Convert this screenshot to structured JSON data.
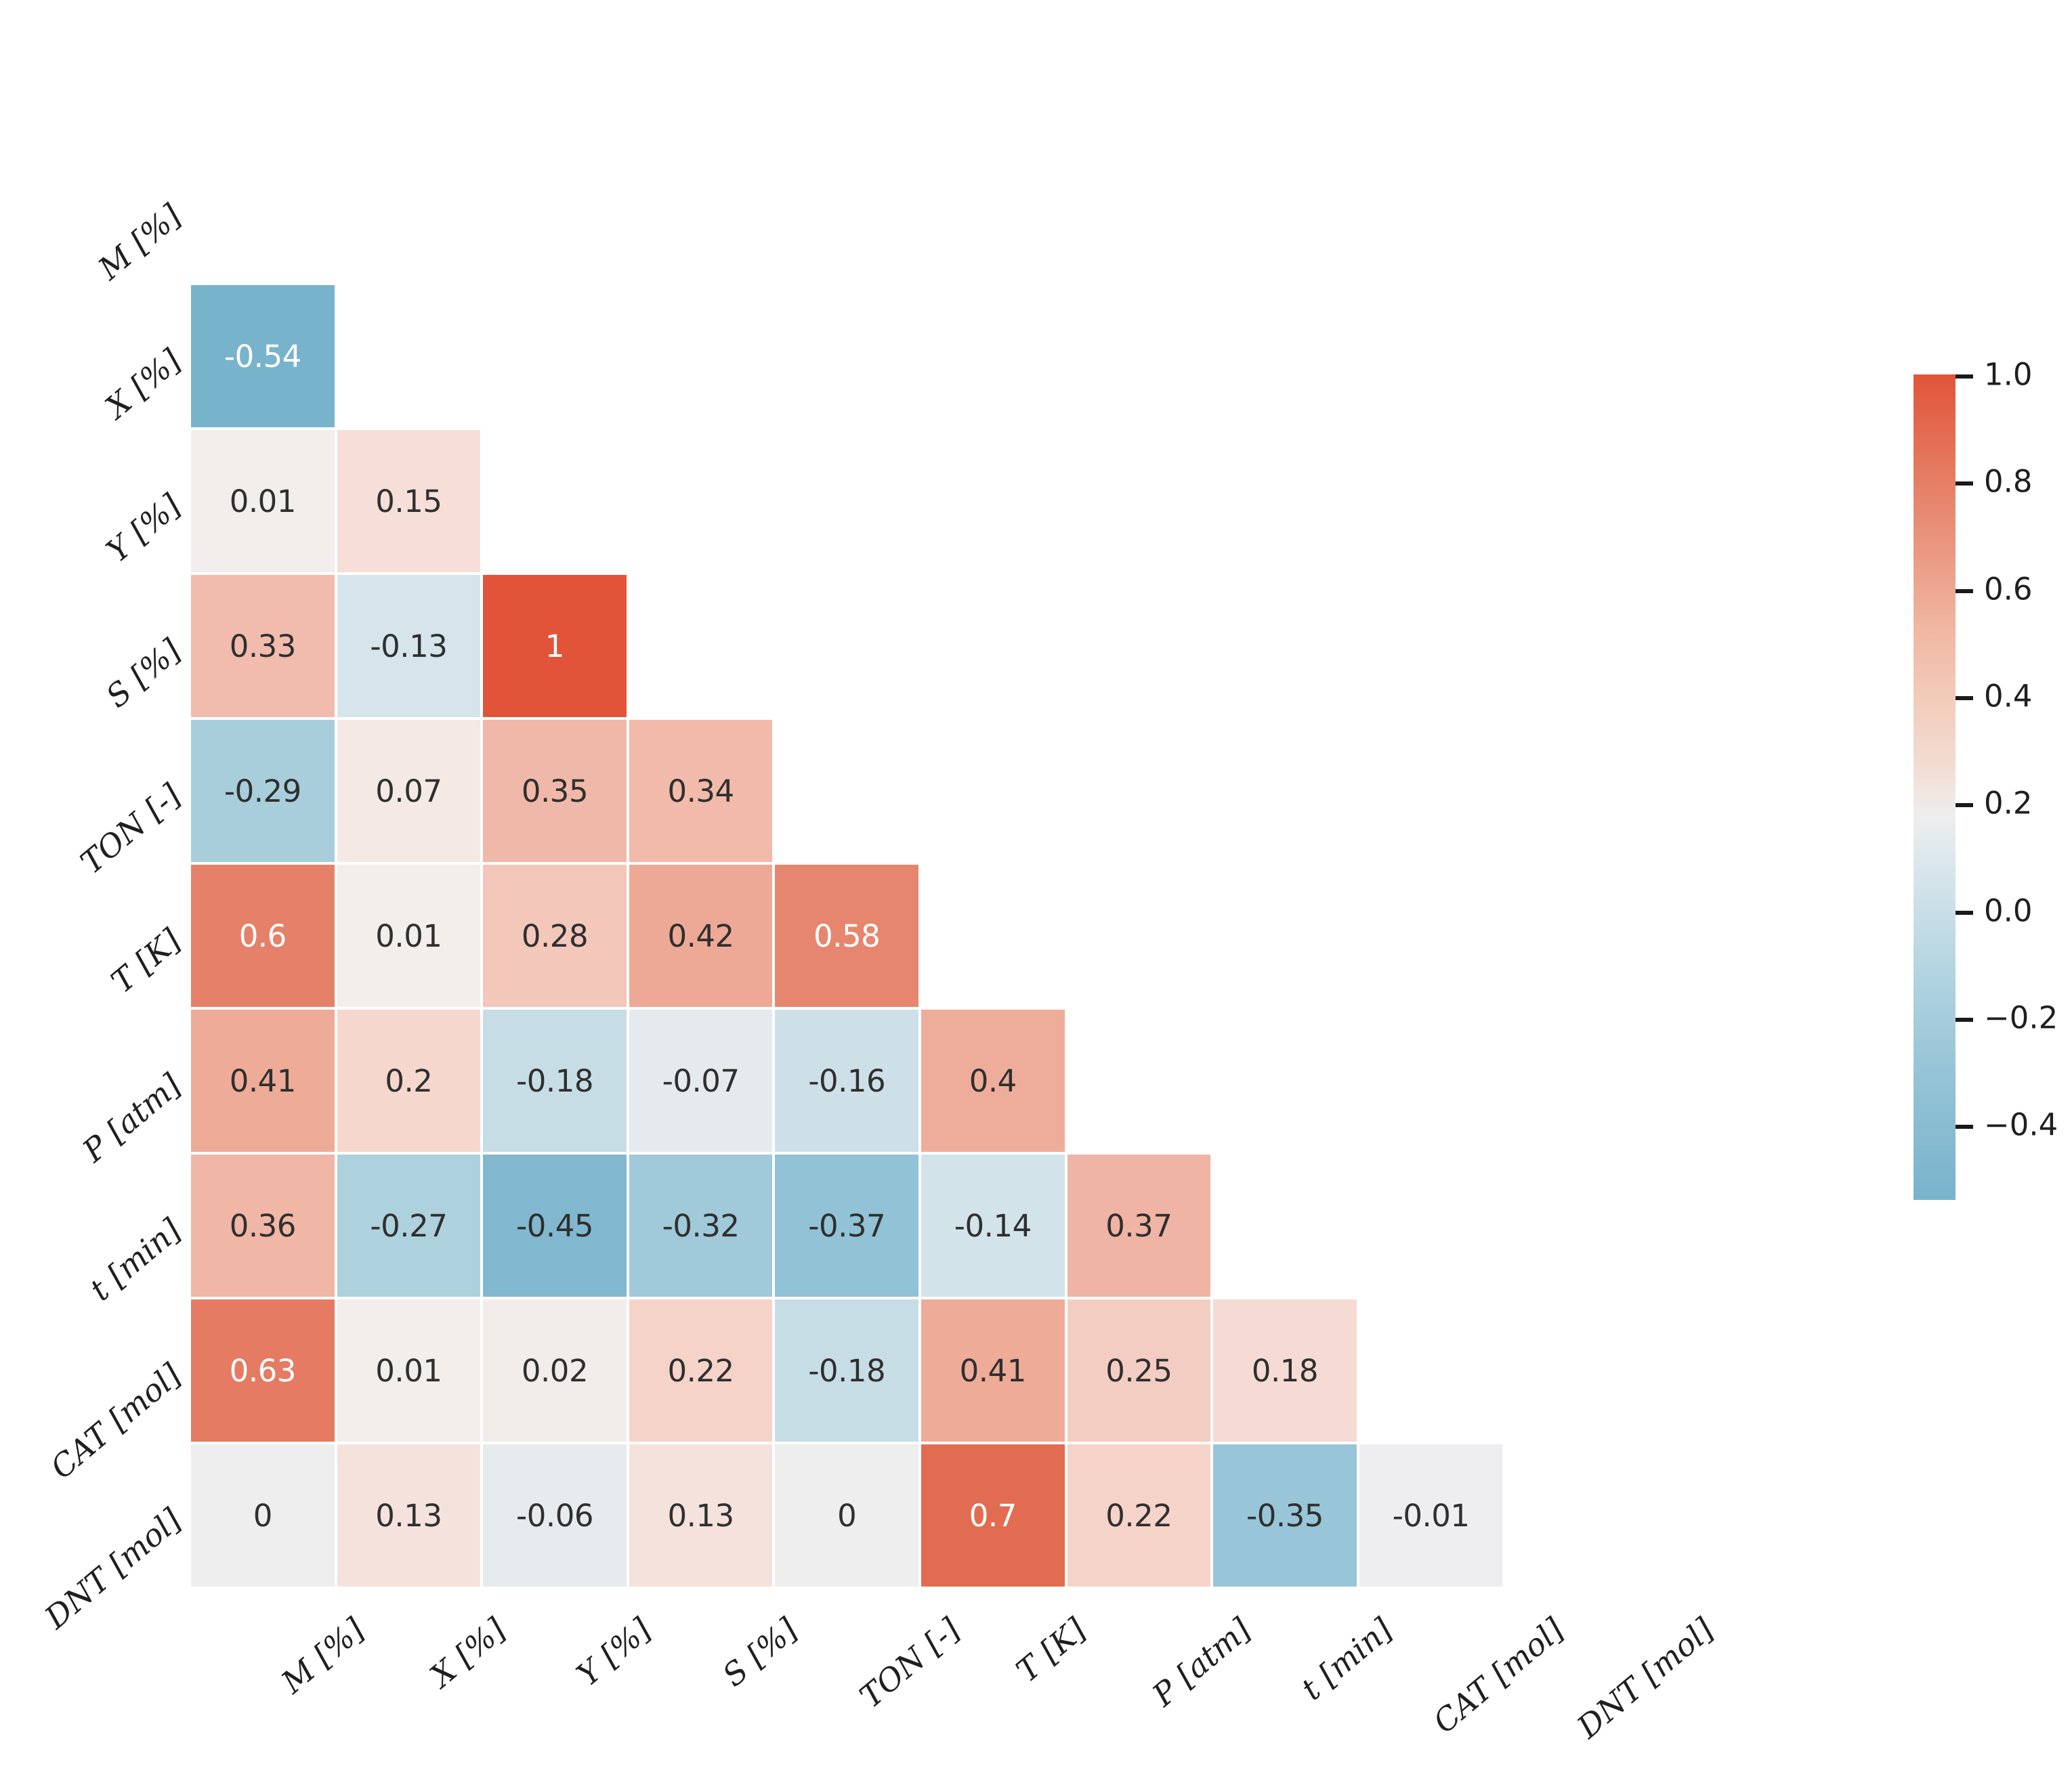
{
  "chart_data": {
    "type": "heatmap",
    "title": "",
    "subtitle": "",
    "xlabel": "",
    "ylabel": "",
    "grid": false,
    "legend_position": "right",
    "mask": "lower-triangle (upper triangle hidden, diagonal hidden)",
    "categories": [
      "M [%]",
      "X [%]",
      "Y [%]",
      "S [%]",
      "TON [-]",
      "T [K]",
      "P [atm]",
      "t [min]",
      "CAT [mol]",
      "DNT [mol]"
    ],
    "x_tick_labels": [
      "M [%]",
      "X [%]",
      "Y [%]",
      "S [%]",
      "TON [-]",
      "T [K]",
      "P [atm]",
      "t [min]",
      "CAT [mol]",
      "DNT [mol]"
    ],
    "y_tick_labels": [
      "M [%]",
      "X [%]",
      "Y [%]",
      "S [%]",
      "TON [-]",
      "T [K]",
      "P [atm]",
      "t [min]",
      "CAT [mol]",
      "DNT [mol]"
    ],
    "colormap": "coolwarm-diverging (blue-white-red)",
    "color_low": "#78b3cc",
    "color_mid": "#eeeeee",
    "color_high": "#e1543a",
    "vmin": -0.54,
    "vmax": 1.0,
    "colorbar": {
      "ticks": [
        "1.0",
        "0.8",
        "0.6",
        "0.4",
        "0.2",
        "0.0",
        "−0.2",
        "−0.4"
      ],
      "tick_values": [
        1.0,
        0.8,
        0.6,
        0.4,
        0.2,
        0.0,
        -0.2,
        -0.4
      ],
      "range": [
        -0.54,
        1.0
      ]
    },
    "rows": [
      {
        "label": "M [%]",
        "values": [
          null,
          null,
          null,
          null,
          null,
          null,
          null,
          null,
          null,
          null
        ],
        "display": [
          "",
          "",
          "",
          "",
          "",
          "",
          "",
          "",
          "",
          ""
        ]
      },
      {
        "label": "X [%]",
        "values": [
          -0.54,
          null,
          null,
          null,
          null,
          null,
          null,
          null,
          null,
          null
        ],
        "display": [
          "-0.54",
          "",
          "",
          "",
          "",
          "",
          "",
          "",
          "",
          ""
        ]
      },
      {
        "label": "Y [%]",
        "values": [
          0.01,
          0.15,
          null,
          null,
          null,
          null,
          null,
          null,
          null,
          null
        ],
        "display": [
          "0.01",
          "0.15",
          "",
          "",
          "",
          "",
          "",
          "",
          "",
          ""
        ]
      },
      {
        "label": "S [%]",
        "values": [
          0.33,
          -0.13,
          1,
          null,
          null,
          null,
          null,
          null,
          null,
          null
        ],
        "display": [
          "0.33",
          "-0.13",
          "1",
          "",
          "",
          "",
          "",
          "",
          "",
          ""
        ]
      },
      {
        "label": "TON [-]",
        "values": [
          -0.29,
          0.07,
          0.35,
          0.34,
          null,
          null,
          null,
          null,
          null,
          null
        ],
        "display": [
          "-0.29",
          "0.07",
          "0.35",
          "0.34",
          "",
          "",
          "",
          "",
          "",
          ""
        ]
      },
      {
        "label": "T [K]",
        "values": [
          0.6,
          0.01,
          0.28,
          0.42,
          0.58,
          null,
          null,
          null,
          null,
          null
        ],
        "display": [
          "0.6",
          "0.01",
          "0.28",
          "0.42",
          "0.58",
          "",
          "",
          "",
          "",
          ""
        ]
      },
      {
        "label": "P [atm]",
        "values": [
          0.41,
          0.2,
          -0.18,
          -0.07,
          -0.16,
          0.4,
          null,
          null,
          null,
          null
        ],
        "display": [
          "0.41",
          "0.2",
          "-0.18",
          "-0.07",
          "-0.16",
          "0.4",
          "",
          "",
          "",
          ""
        ]
      },
      {
        "label": "t [min]",
        "values": [
          0.36,
          -0.27,
          -0.45,
          -0.32,
          -0.37,
          -0.14,
          0.37,
          null,
          null,
          null
        ],
        "display": [
          "0.36",
          "-0.27",
          "-0.45",
          "-0.32",
          "-0.37",
          "-0.14",
          "0.37",
          "",
          "",
          ""
        ]
      },
      {
        "label": "CAT [mol]",
        "values": [
          0.63,
          0.01,
          0.02,
          0.22,
          -0.18,
          0.41,
          0.25,
          0.18,
          null,
          null
        ],
        "display": [
          "0.63",
          "0.01",
          "0.02",
          "0.22",
          "-0.18",
          "0.41",
          "0.25",
          "0.18",
          "",
          ""
        ]
      },
      {
        "label": "DNT [mol]",
        "values": [
          0,
          0.13,
          -0.06,
          0.13,
          0,
          0.7,
          0.22,
          -0.35,
          -0.01,
          null
        ],
        "display": [
          "0",
          "0.13",
          "-0.06",
          "0.13",
          "0",
          "0.7",
          "0.22",
          "-0.35",
          "-0.01",
          ""
        ]
      }
    ]
  }
}
